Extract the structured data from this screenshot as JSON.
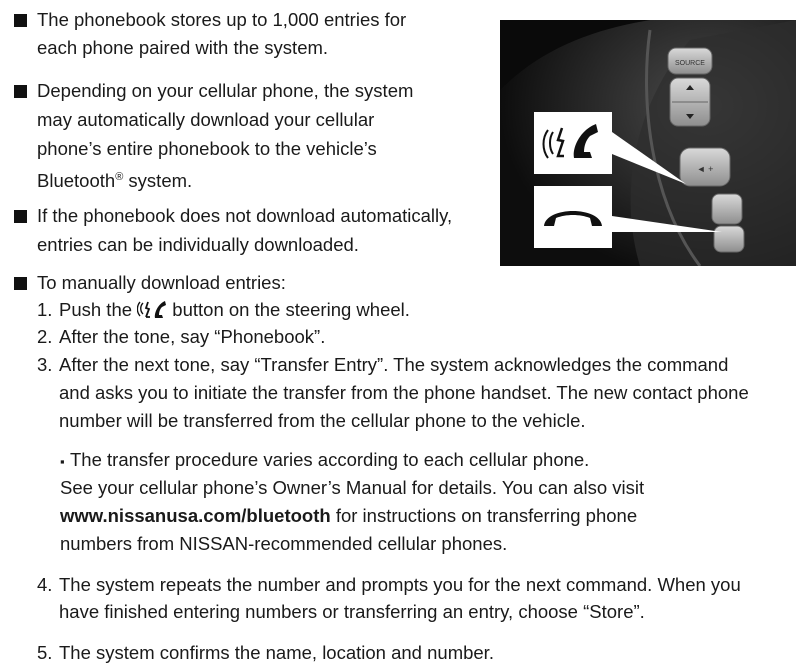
{
  "bullets": [
    {
      "lines": [
        "The phonebook stores up to 1,000 entries for",
        "each phone paired with the system."
      ]
    },
    {
      "lines": [
        "Depending on your cellular phone, the system",
        "may automatically download your cellular",
        "phone’s entire phonebook to the vehicle’s"
      ],
      "last_pre": "Bluetooth",
      "last_sup": "®",
      "last_post": " system."
    },
    {
      "lines": [
        "If the phonebook does not download automatically,",
        "entries can be individually downloaded."
      ]
    },
    {
      "lines": [
        "To manually download entries:"
      ]
    }
  ],
  "steps": {
    "s1_num": "1.",
    "s1_pre": "Push the ",
    "s1_post": " button on the steering wheel.",
    "s2_num": "2.",
    "s2": "After the tone, say “Phonebook”.",
    "s3_num": "3.",
    "s3_lines": [
      "After the next tone, say “Transfer Entry”. The system acknowledges the command",
      "and asks you to initiate the transfer from the phone handset. The new contact phone",
      "number will be transferred from the cellular phone to the vehicle."
    ],
    "sub_bullet": "▪",
    "sub_lines": [
      "The transfer procedure varies according to each cellular phone.",
      "See your cellular phone’s Owner’s Manual for details. You can also visit"
    ],
    "sub_link": "www.nissanusa.com/bluetooth",
    "sub_after_link": " for instructions on transferring phone",
    "sub_last": "numbers from NISSAN-recommended cellular phones.",
    "s4_num": "4.",
    "s4_lines": [
      "The system repeats the number and prompts you for the next command. When you",
      "have finished entering numbers or transferring an entry, choose “Store”."
    ],
    "s5_num": "5.",
    "s5": "The system confirms the name, location and number."
  },
  "photo": {
    "source_label": "SOURCE",
    "icon_names": [
      "talk-phone-icon",
      "hang-up-icon"
    ]
  }
}
